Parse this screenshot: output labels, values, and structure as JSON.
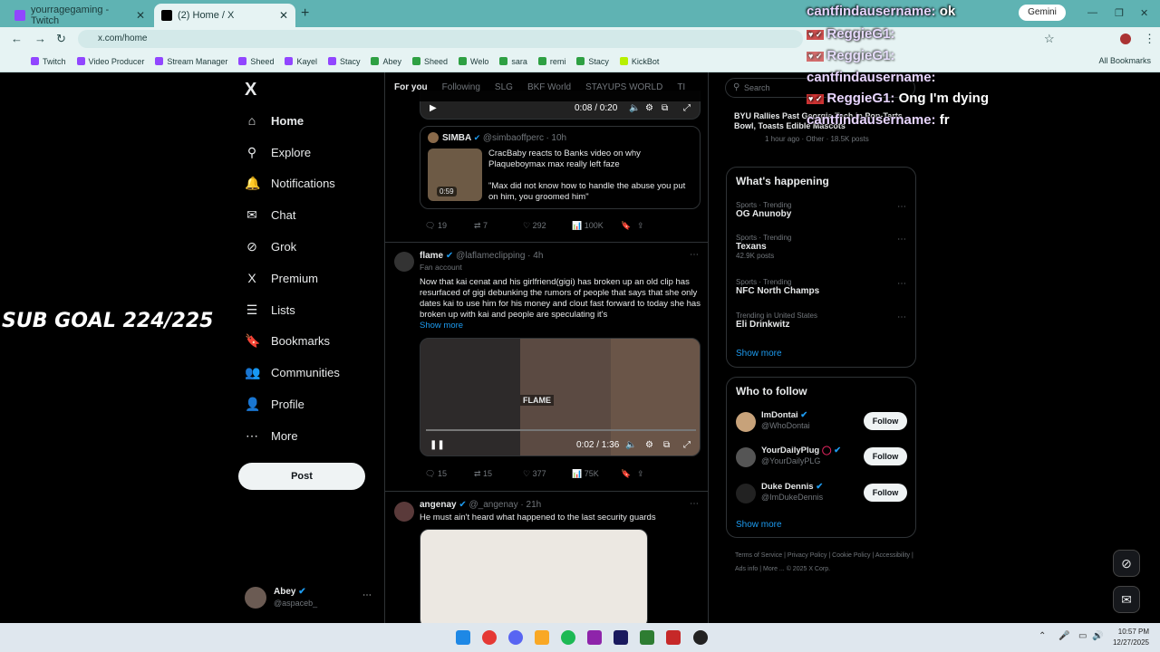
{
  "browser": {
    "tabs": [
      {
        "title": "yourragegaming - Twitch",
        "icon_color": "#9146ff"
      },
      {
        "title": "(2) Home / X",
        "icon_color": "#000000"
      }
    ],
    "url": "x.com/home",
    "gemini_label": "Gemini",
    "bookmarks": [
      "Twitch",
      "Video Producer",
      "Stream Manager",
      "Sheed",
      "Kayel",
      "Stacy",
      "Abey",
      "Sheed",
      "Welo",
      "sara",
      "remi",
      "Stacy",
      "KickBot"
    ],
    "all_bookmarks": "All Bookmarks"
  },
  "stream_overlay": {
    "sub_goal": "SUB GOAL 224/225",
    "chat": [
      {
        "user": "cantfindausername:",
        "msg": "ok"
      },
      {
        "user": "ReggieG1:",
        "msg": ""
      },
      {
        "user": "ReggieG1:",
        "msg": ""
      },
      {
        "user": "cantfindausername:",
        "msg": ""
      },
      {
        "user": "ReggieG1:",
        "msg": "Ong I'm dying"
      },
      {
        "user": "cantfindausername:",
        "msg": "fr"
      }
    ]
  },
  "sidebar": {
    "logo": "X",
    "items": [
      {
        "label": "Home",
        "icon": "home-icon",
        "glyph": "⌂"
      },
      {
        "label": "Explore",
        "icon": "search-icon",
        "glyph": "⚲"
      },
      {
        "label": "Notifications",
        "icon": "bell-icon",
        "glyph": "🔔"
      },
      {
        "label": "Chat",
        "icon": "mail-icon",
        "glyph": "✉"
      },
      {
        "label": "Grok",
        "icon": "grok-icon",
        "glyph": "⊘"
      },
      {
        "label": "Premium",
        "icon": "x-icon",
        "glyph": "X"
      },
      {
        "label": "Lists",
        "icon": "list-icon",
        "glyph": "☰"
      },
      {
        "label": "Bookmarks",
        "icon": "bookmark-icon",
        "glyph": "🔖"
      },
      {
        "label": "Communities",
        "icon": "people-icon",
        "glyph": "👥"
      },
      {
        "label": "Profile",
        "icon": "person-icon",
        "glyph": "👤"
      },
      {
        "label": "More",
        "icon": "more-icon",
        "glyph": "⋯"
      }
    ],
    "post_label": "Post",
    "account": {
      "name": "Abey",
      "handle": "@aspaceb_"
    }
  },
  "feed": {
    "tabs": [
      "For you",
      "Following",
      "SLG",
      "BKF World",
      "STAYUPS WORLD",
      "TI"
    ],
    "tweet1": {
      "video_time": "0:08 / 0:20",
      "quote_name": "SIMBA",
      "quote_handle": "@simbaoffperc",
      "quote_age": "10h",
      "quote_duration": "0:59",
      "quote_text1": "CracBaby reacts to Banks video on why Plaqueboymax max really left faze",
      "quote_text2": "\"Max did not know how to handle the abuse you put on him, you groomed him\"",
      "replies": "19",
      "reposts": "7",
      "likes": "292",
      "views": "100K"
    },
    "tweet2": {
      "name": "flame",
      "handle": "@laflameclipping",
      "age": "4h",
      "badge": "Fan account",
      "text": "Now that kai cenat and his girlfriend(gigi) has broken up an old clip has resurfaced of gigi debunking the rumors of people that says that she only dates kai to use him for his money and clout fast forward to today she has broken up with kai and people are speculating it's",
      "show_more": "Show more",
      "watermark": "FLAME",
      "video_time": "0:02 / 1:36",
      "replies": "15",
      "reposts": "15",
      "likes": "377",
      "views": "75K"
    },
    "tweet3": {
      "name": "angenay",
      "handle": "@_angenay",
      "age": "21h",
      "text": "He must ain't heard what happened to the last security guards"
    }
  },
  "right": {
    "search_placeholder": "Search",
    "top_news": {
      "title": "BYU Rallies Past Georgia Tech in Pop-Tarts Bowl, Toasts Edible Mascots",
      "meta": "1 hour ago · Other · 18.5K posts"
    },
    "happening_title": "What's happening",
    "trends": [
      {
        "meta": "Sports · Trending",
        "name": "OG Anunoby",
        "posts": ""
      },
      {
        "meta": "Sports · Trending",
        "name": "Texans",
        "posts": "42.9K posts"
      },
      {
        "meta": "Sports · Trending",
        "name": "NFC North Champs",
        "posts": ""
      },
      {
        "meta": "Trending in United States",
        "name": "Eli Drinkwitz",
        "posts": ""
      }
    ],
    "show_more": "Show more",
    "who_title": "Who to follow",
    "follow": [
      {
        "name": "ImDontai",
        "handle": "@WhoDontai",
        "btn": "Follow"
      },
      {
        "name": "YourDailyPlug",
        "handle": "@YourDailyPLG",
        "btn": "Follow"
      },
      {
        "name": "Duke Dennis",
        "handle": "@ImDukeDennis",
        "btn": "Follow"
      }
    ],
    "footer": [
      "Terms of Service",
      "Privacy Policy",
      "Cookie Policy",
      "Accessibility",
      "Ads info",
      "More ...",
      "© 2025 X Corp."
    ]
  },
  "taskbar": {
    "time": "10:57 PM",
    "date": "12/27/2025"
  }
}
